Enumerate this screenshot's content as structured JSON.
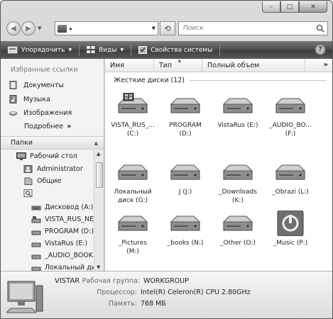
{
  "window": {
    "caption": {
      "minimize": "–",
      "maximize": "□",
      "close": "✕"
    }
  },
  "address_bar": {
    "path_arrow": "▸",
    "refresh_glyph": "⟲",
    "search_placeholder": "Поиск"
  },
  "toolbar": {
    "organize": "Упорядочить",
    "views": "Виды",
    "system_properties": "Свойства системы",
    "help": "?"
  },
  "nav_pane": {
    "favorites_title": "Избранные ссылки",
    "favorites": [
      {
        "label": "Документы",
        "icon": "documents-icon"
      },
      {
        "label": "Музыка",
        "icon": "music-icon"
      },
      {
        "label": "Изображения",
        "icon": "pictures-icon"
      }
    ],
    "more_label": "Подробнее",
    "more_chevron": "»",
    "folders_title": "Папки",
    "tree": [
      {
        "label": "Рабочий стол",
        "icon": "desktop-icon"
      },
      {
        "label": "Administrator",
        "icon": "user-folder-icon"
      },
      {
        "label": "Общие",
        "icon": "public-folder-icon"
      },
      {
        "label": "",
        "icon": "search-folder-icon"
      },
      {
        "label": "Дисковод (A:)",
        "icon": "floppy-drive-icon"
      },
      {
        "label": "VISTA_RUS_NE",
        "icon": "system-drive-icon"
      },
      {
        "label": "PROGRAM (D:)",
        "icon": "drive-icon"
      },
      {
        "label": "VistaRus (E:)",
        "icon": "drive-icon"
      },
      {
        "label": "_AUDIO_BOOK",
        "icon": "drive-icon"
      },
      {
        "label": "Локальный ди",
        "icon": "drive-icon"
      }
    ]
  },
  "file_pane": {
    "columns": [
      "Имя",
      "Тип",
      "Полный объем"
    ],
    "columns_more": "»",
    "group_title": "Жесткие диски (12)",
    "drives": [
      {
        "line1": "VISTA_RUS_...",
        "line2": "(C:)",
        "icon": "system-drive-icon"
      },
      {
        "line1": "PROGRAM",
        "line2": "(D:)",
        "icon": "drive-icon"
      },
      {
        "line1": "VistaRus (E:)",
        "line2": "",
        "icon": "drive-icon"
      },
      {
        "line1": "_AUDIO_BO...",
        "line2": "(F:)",
        "icon": "drive-icon"
      },
      {
        "line1": "Локальный",
        "line2": "диск (G:)",
        "icon": "drive-icon"
      },
      {
        "line1": "J (J:)",
        "line2": "",
        "icon": "drive-icon"
      },
      {
        "line1": "_Downloads",
        "line2": "(K:)",
        "icon": "drive-icon"
      },
      {
        "line1": "_Obrazi (L:)",
        "line2": "",
        "icon": "drive-icon"
      },
      {
        "line1": "_Pictures",
        "line2": "(M:)",
        "icon": "drive-icon"
      },
      {
        "line1": "_books (N:)",
        "line2": "",
        "icon": "drive-icon"
      },
      {
        "line1": "_Other (O:)",
        "line2": "",
        "icon": "drive-icon"
      },
      {
        "line1": "_Music (P:)",
        "line2": "",
        "icon": "power-drive-icon"
      }
    ]
  },
  "details": {
    "computer_name": "VISTAR",
    "rows": [
      {
        "label": "Рабочая группа:",
        "value": "WORKGROUP"
      },
      {
        "label": "Процессор:",
        "value": "Intel(R) Celeron(R) CPU 2.80GHz"
      },
      {
        "label": "Память:",
        "value": "768 МБ"
      }
    ]
  }
}
